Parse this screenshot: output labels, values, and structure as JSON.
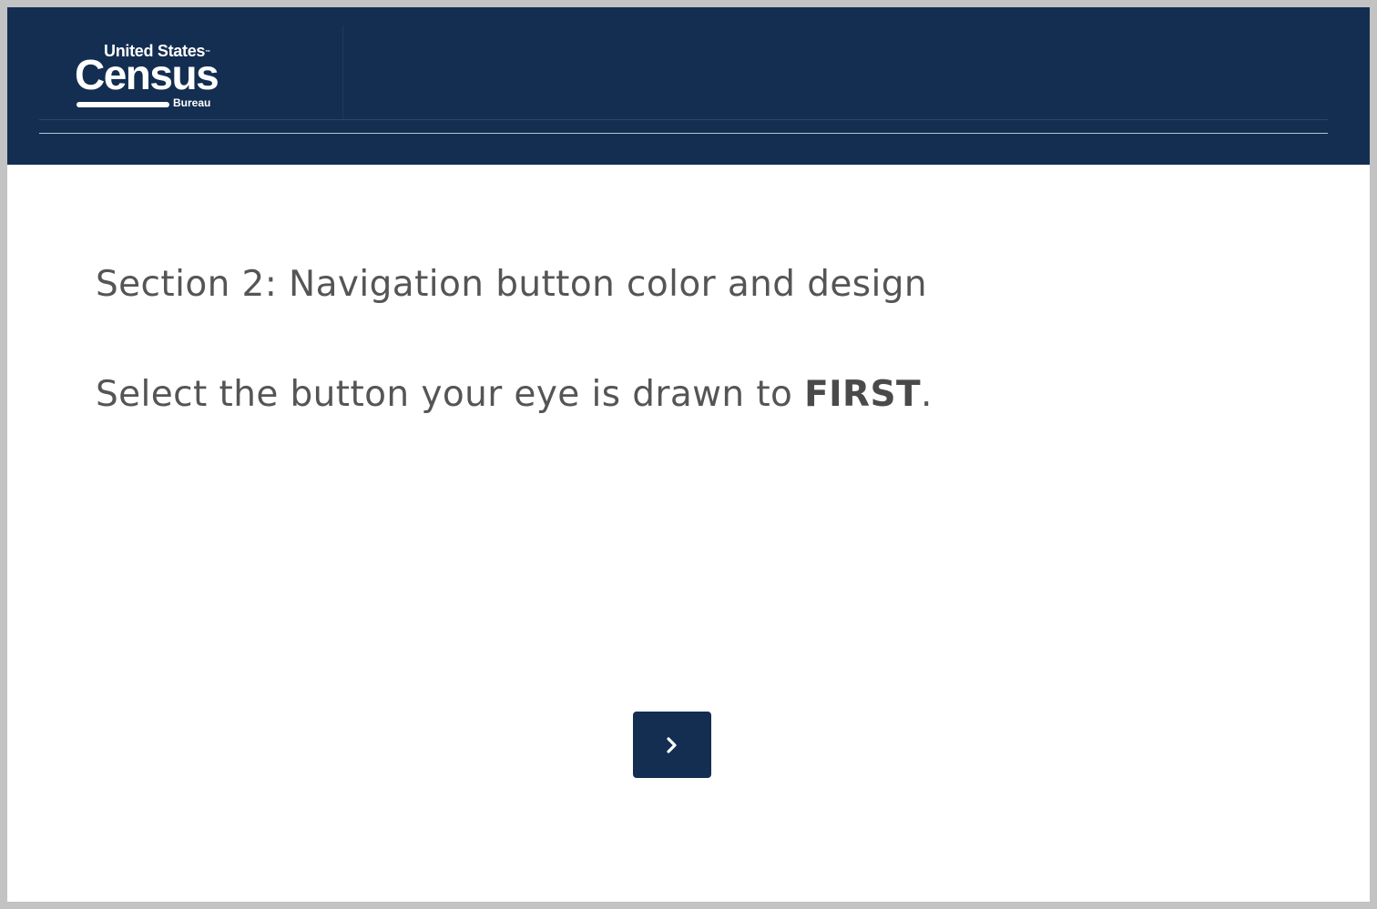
{
  "header": {
    "logo": {
      "top_text": "United States",
      "tm": "™",
      "main_text": "Census",
      "sub_text": "Bureau"
    },
    "background_color": "#132e51"
  },
  "content": {
    "section_title": "Section 2:  Navigation button color and design",
    "instruction_prefix": "Select the button your eye is drawn to ",
    "instruction_emphasis": "FIRST",
    "instruction_suffix": "."
  },
  "navigation": {
    "next_button": {
      "icon": "chevron-right-icon",
      "color": "#132e51"
    }
  }
}
